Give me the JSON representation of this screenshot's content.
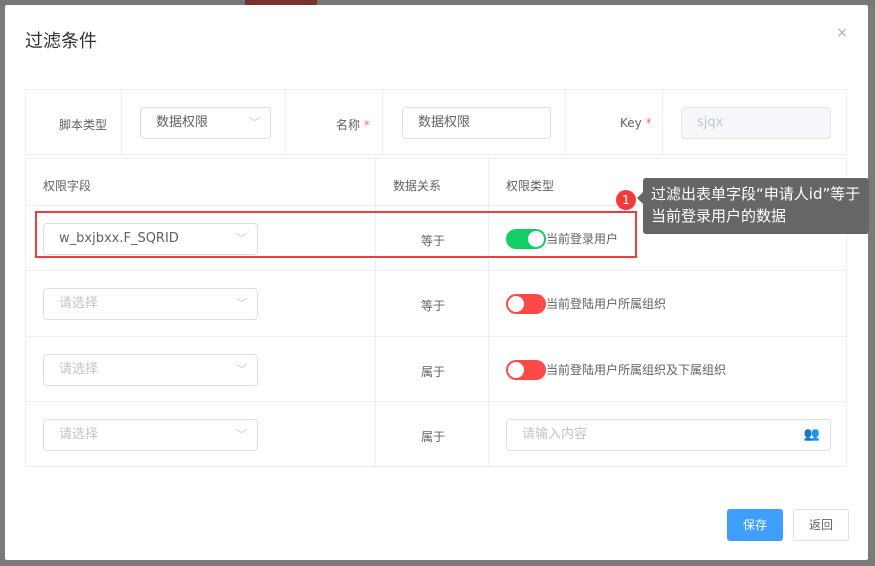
{
  "dialog": {
    "title": "过滤条件",
    "close": "×"
  },
  "form": {
    "script_type_label": "脚本类型",
    "script_type_value": "数据权限",
    "name_label": "名称",
    "name_value": "数据权限",
    "key_label": "Key",
    "key_value": "sjqx",
    "required": "*"
  },
  "table": {
    "headers": [
      "权限字段",
      "数据关系",
      "权限类型"
    ],
    "rows": [
      {
        "field": "w_bxjbxx.F_SQRID",
        "field_placeholder": "",
        "relation": "等于",
        "switch_on": true,
        "type_label": "当前登录用户"
      },
      {
        "field": "",
        "field_placeholder": "请选择",
        "relation": "等于",
        "switch_on": false,
        "type_label": "当前登陆用户所属组织"
      },
      {
        "field": "",
        "field_placeholder": "请选择",
        "relation": "属于",
        "switch_on": false,
        "type_label": "当前登陆用户所属组织及下属组织"
      },
      {
        "field": "",
        "field_placeholder": "请选择",
        "relation": "属于",
        "input_placeholder": "请输入内容"
      }
    ]
  },
  "tooltip": {
    "badge": "1",
    "text": "过滤出表单字段“申请人id”等于当前登录用户的数据"
  },
  "colors": {
    "on": "#13ce66",
    "off": "#ff4949",
    "primary": "#409eff"
  },
  "footer": {
    "save": "保存",
    "back": "返回"
  }
}
